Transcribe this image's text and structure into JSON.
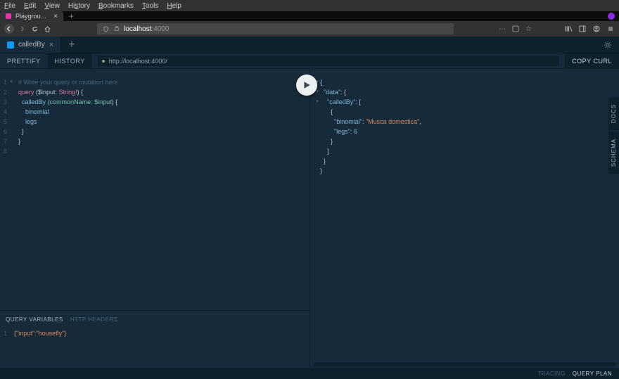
{
  "menu": {
    "file": "File",
    "edit": "Edit",
    "view": "View",
    "history": "History",
    "bookmarks": "Bookmarks",
    "tools": "Tools",
    "help": "Help"
  },
  "browser": {
    "tab_title": "Playground - http://local…",
    "url_host": "localhost",
    "url_path": ":4000"
  },
  "playground": {
    "tab_name": "calledBy",
    "actions": {
      "prettify": "PRETTIFY",
      "history": "HISTORY",
      "copy_curl": "COPY CURL"
    },
    "endpoint": "http://localhost:4000/",
    "side": {
      "docs": "DOCS",
      "schema": "SCHEMA"
    }
  },
  "query": {
    "placeholder": "# Write your query or mutation here",
    "lines": {
      "l2a": "query",
      "l2b": "($input:",
      "l2c": "String!",
      "l2d": ") {",
      "l3a": "calledBy",
      "l3b": "(commonName:",
      "l3c": "$input",
      "l3d": ") {",
      "l4": "binomial",
      "l5": "legs",
      "l6": "}",
      "l7": "}"
    },
    "gutter": [
      "1",
      "2",
      "3",
      "4",
      "5",
      "6",
      "7",
      "8"
    ]
  },
  "variables": {
    "tabs": {
      "vars": "QUERY VARIABLES",
      "headers": "HTTP HEADERS"
    },
    "line": "{\"input\":\"housefly\"}"
  },
  "result": {
    "data_label": "\"data\"",
    "calledby_label": "\"calledBy\"",
    "binomial_label": "\"binomial\"",
    "binomial_value": "\"Musca domestica\"",
    "legs_label": "\"legs\"",
    "legs_value": "6"
  },
  "footer": {
    "tracing": "TRACING",
    "query_plan": "QUERY PLAN"
  }
}
